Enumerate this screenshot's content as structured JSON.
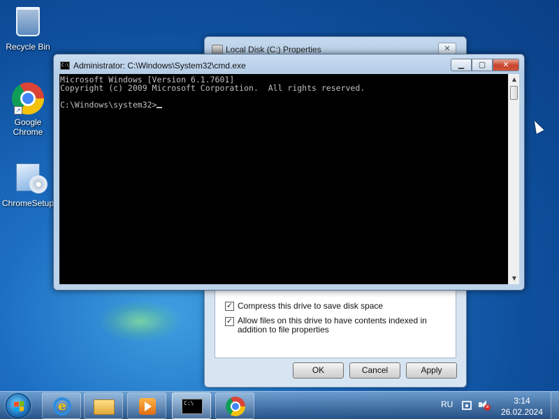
{
  "desktop": {
    "icons": [
      {
        "label": "Recycle Bin",
        "icon": "recycle-bin-icon"
      },
      {
        "label": "Google\nChrome",
        "icon": "chrome-icon"
      },
      {
        "label": "ChromeSetup",
        "icon": "installer-icon"
      }
    ]
  },
  "properties_dialog": {
    "title": "Local Disk (C:) Properties",
    "close_label": "✕",
    "checkboxes": [
      {
        "label": "Compress this drive to save disk space",
        "checked": true
      },
      {
        "label": "Allow files on this drive to have contents indexed in addition to file properties",
        "checked": true
      }
    ],
    "buttons": {
      "ok": "OK",
      "cancel": "Cancel",
      "apply": "Apply"
    }
  },
  "cmd_window": {
    "title": "Administrator: C:\\Windows\\System32\\cmd.exe",
    "icon_text": "C:\\",
    "buttons": {
      "minimize": "▁",
      "maximize": "▢",
      "close": "✕"
    },
    "lines": [
      "Microsoft Windows [Version 6.1.7601]",
      "Copyright (c) 2009 Microsoft Corporation.  All rights reserved.",
      "",
      "C:\\Windows\\system32>"
    ]
  },
  "taskbar": {
    "apps": [
      "internet-explorer-icon",
      "file-explorer-icon",
      "media-player-icon",
      "command-prompt-icon",
      "chrome-icon"
    ],
    "active_app": "command-prompt-icon",
    "tray": {
      "language": "RU",
      "time": "3:14",
      "date": "26.02.2024"
    }
  },
  "colors": {
    "console_bg": "#000000",
    "console_fg": "#c0c0c0",
    "close_button": "#c8432b"
  }
}
